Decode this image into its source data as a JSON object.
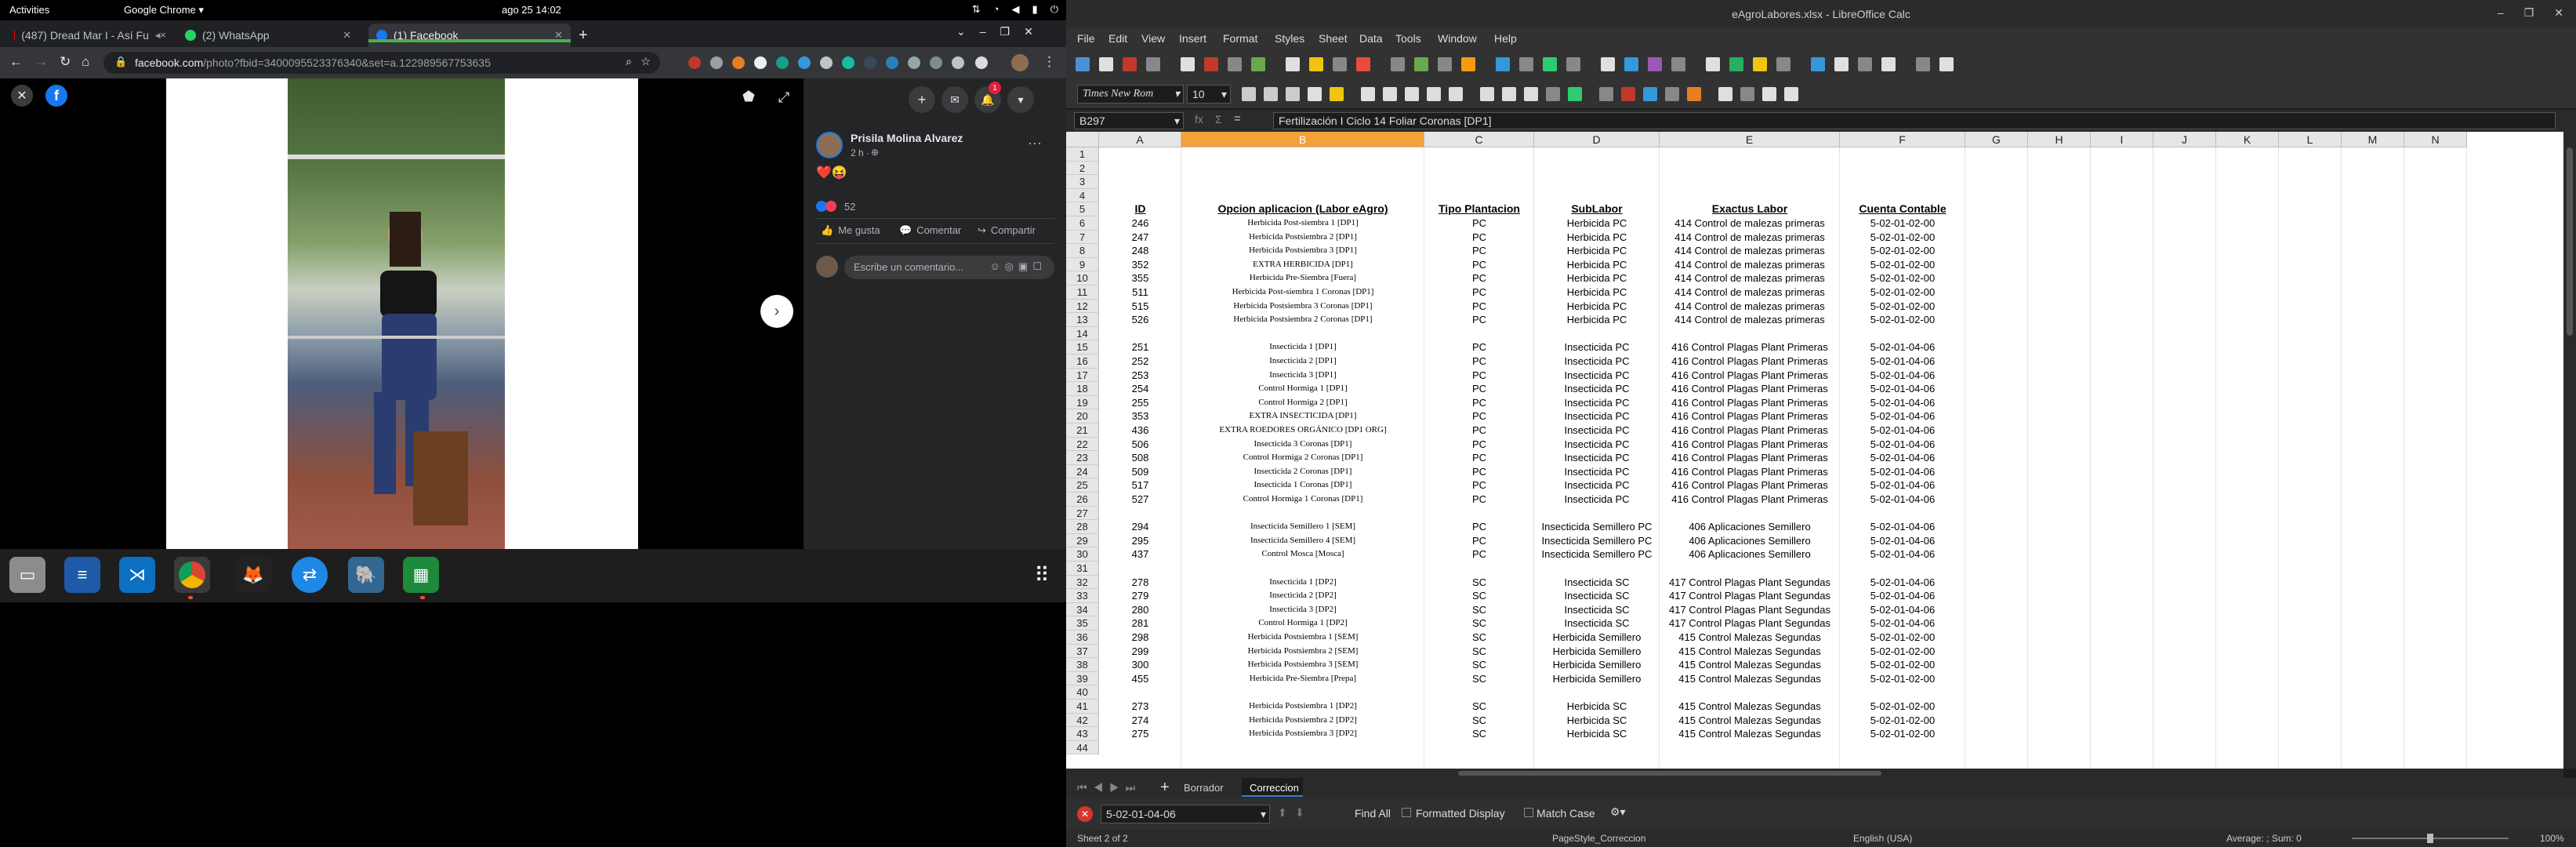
{
  "topbar": {
    "activities": "Activities",
    "app": "Google Chrome ▾",
    "clock": "ago 25  14:02"
  },
  "chrome": {
    "tabs": [
      {
        "label": "(487) Dread Mar I - Así Fu"
      },
      {
        "label": "(2) WhatsApp"
      },
      {
        "label": "(1) Facebook"
      }
    ],
    "url_prefix": "facebook.com",
    "url_rest": "/photo?fbid=340009552337634​0&set=a.12298956775​3635"
  },
  "facebook": {
    "author": "Prisila Molina Alvarez",
    "time": "2 h · ",
    "reaction_emoji": "❤️😝",
    "reaction_count": "52",
    "like": "Me gusta",
    "comment": "Comentar",
    "share": "Compartir",
    "comment_placeholder": "Escribe un comentario...",
    "notif_count": "1"
  },
  "calc": {
    "title": "eAgroLabores.xlsx - LibreOffice Calc",
    "menu": [
      "File",
      "Edit",
      "View",
      "Insert",
      "Format",
      "Styles",
      "Sheet",
      "Data",
      "Tools",
      "Window",
      "Help"
    ],
    "font_name": "Times New Rom",
    "font_size": "10",
    "name_box": "B297",
    "formula": "Fertilización I Ciclo 14 Foliar Coronas [DP1]",
    "columns": [
      "A",
      "B",
      "C",
      "D",
      "E",
      "F",
      "G",
      "H",
      "I",
      "J",
      "K",
      "L",
      "M",
      "N"
    ],
    "rows": [
      {
        "n": "1"
      },
      {
        "n": "2"
      },
      {
        "n": "3"
      },
      {
        "n": "4"
      },
      {
        "n": "5",
        "a": "ID",
        "b": "Opcion aplicacion (Labor eAgro)",
        "c": "Tipo Plantacion",
        "d": "SubLabor",
        "e": "Exactus Labor",
        "f": "Cuenta Contable",
        "h": true
      },
      {
        "n": "6",
        "a": "246",
        "b": "Herbicida Post-siembra 1 [DP1]",
        "c": "PC",
        "d": "Herbicida PC",
        "e": "414 Control de malezas primeras",
        "f": "5-02-01-02-00"
      },
      {
        "n": "7",
        "a": "247",
        "b": "Herbicida Postsiembra 2 [DP1]",
        "c": "PC",
        "d": "Herbicida PC",
        "e": "414 Control de malezas primeras",
        "f": "5-02-01-02-00"
      },
      {
        "n": "8",
        "a": "248",
        "b": "Herbicida Postsiembra 3 [DP1]",
        "c": "PC",
        "d": "Herbicida PC",
        "e": "414 Control de malezas primeras",
        "f": "5-02-01-02-00"
      },
      {
        "n": "9",
        "a": "352",
        "b": "EXTRA HERBICIDA [DP1]",
        "c": "PC",
        "d": "Herbicida PC",
        "e": "414 Control de malezas primeras",
        "f": "5-02-01-02-00"
      },
      {
        "n": "10",
        "a": "355",
        "b": "Herbicida Pre-Siembra [Fuera]",
        "c": "PC",
        "d": "Herbicida PC",
        "e": "414 Control de malezas primeras",
        "f": "5-02-01-02-00"
      },
      {
        "n": "11",
        "a": "511",
        "b": "Herbicida Post-siembra 1 Coronas [DP1]",
        "c": "PC",
        "d": "Herbicida PC",
        "e": "414 Control de malezas primeras",
        "f": "5-02-01-02-00"
      },
      {
        "n": "12",
        "a": "515",
        "b": "Herbicida Postsiembra 3 Coronas [DP1]",
        "c": "PC",
        "d": "Herbicida PC",
        "e": "414 Control de malezas primeras",
        "f": "5-02-01-02-00"
      },
      {
        "n": "13",
        "a": "526",
        "b": "Herbicida Postsiembra 2 Coronas [DP1]",
        "c": "PC",
        "d": "Herbicida PC",
        "e": "414 Control de malezas primeras",
        "f": "5-02-01-02-00"
      },
      {
        "n": "14"
      },
      {
        "n": "15",
        "a": "251",
        "b": "Insecticida 1 [DP1]",
        "c": "PC",
        "d": "Insecticida PC",
        "e": "416 Control Plagas Plant Primeras",
        "f": "5-02-01-04-06"
      },
      {
        "n": "16",
        "a": "252",
        "b": "Insecticida 2 [DP1]",
        "c": "PC",
        "d": "Insecticida PC",
        "e": "416 Control Plagas Plant Primeras",
        "f": "5-02-01-04-06"
      },
      {
        "n": "17",
        "a": "253",
        "b": "Insecticida 3 [DP1]",
        "c": "PC",
        "d": "Insecticida PC",
        "e": "416 Control Plagas Plant Primeras",
        "f": "5-02-01-04-06"
      },
      {
        "n": "18",
        "a": "254",
        "b": "Control Hormiga 1 [DP1]",
        "c": "PC",
        "d": "Insecticida PC",
        "e": "416 Control Plagas Plant Primeras",
        "f": "5-02-01-04-06"
      },
      {
        "n": "19",
        "a": "255",
        "b": "Control Hormiga 2 [DP1]",
        "c": "PC",
        "d": "Insecticida PC",
        "e": "416 Control Plagas Plant Primeras",
        "f": "5-02-01-04-06"
      },
      {
        "n": "20",
        "a": "353",
        "b": "EXTRA INSECTICIDA [DP1]",
        "c": "PC",
        "d": "Insecticida PC",
        "e": "416 Control Plagas Plant Primeras",
        "f": "5-02-01-04-06"
      },
      {
        "n": "21",
        "a": "436",
        "b": "EXTRA ROEDORES ORGÁNICO [DP1 ORG]",
        "c": "PC",
        "d": "Insecticida PC",
        "e": "416 Control Plagas Plant Primeras",
        "f": "5-02-01-04-06"
      },
      {
        "n": "22",
        "a": "506",
        "b": "Insecticida 3 Coronas [DP1]",
        "c": "PC",
        "d": "Insecticida PC",
        "e": "416 Control Plagas Plant Primeras",
        "f": "5-02-01-04-06"
      },
      {
        "n": "23",
        "a": "508",
        "b": "Control Hormiga 2 Coronas [DP1]",
        "c": "PC",
        "d": "Insecticida PC",
        "e": "416 Control Plagas Plant Primeras",
        "f": "5-02-01-04-06"
      },
      {
        "n": "24",
        "a": "509",
        "b": "Insecticida 2 Coronas [DP1]",
        "c": "PC",
        "d": "Insecticida PC",
        "e": "416 Control Plagas Plant Primeras",
        "f": "5-02-01-04-06"
      },
      {
        "n": "25",
        "a": "517",
        "b": "Insecticida 1 Coronas [DP1]",
        "c": "PC",
        "d": "Insecticida PC",
        "e": "416 Control Plagas Plant Primeras",
        "f": "5-02-01-04-06"
      },
      {
        "n": "26",
        "a": "527",
        "b": "Control Hormiga 1 Coronas [DP1]",
        "c": "PC",
        "d": "Insecticida PC",
        "e": "416 Control Plagas Plant Primeras",
        "f": "5-02-01-04-06"
      },
      {
        "n": "27"
      },
      {
        "n": "28",
        "a": "294",
        "b": "Insecticida Semillero 1 [SEM]",
        "c": "PC",
        "d": "Insecticida Semillero PC",
        "e": "406 Aplicaciones Semillero",
        "f": "5-02-01-04-06"
      },
      {
        "n": "29",
        "a": "295",
        "b": "Insecticida Semillero 4 [SEM]",
        "c": "PC",
        "d": "Insecticida Semillero PC",
        "e": "406 Aplicaciones Semillero",
        "f": "5-02-01-04-06"
      },
      {
        "n": "30",
        "a": "437",
        "b": "Control Mosca [Mosca]",
        "c": "PC",
        "d": "Insecticida Semillero PC",
        "e": "406 Aplicaciones Semillero",
        "f": "5-02-01-04-06"
      },
      {
        "n": "31"
      },
      {
        "n": "32",
        "a": "278",
        "b": "Insecticida 1 [DP2]",
        "c": "SC",
        "d": "Insecticida SC",
        "e": "417 Control Plagas Plant Segundas",
        "f": "5-02-01-04-06"
      },
      {
        "n": "33",
        "a": "279",
        "b": "Insecticida 2 [DP2]",
        "c": "SC",
        "d": "Insecticida SC",
        "e": "417 Control Plagas Plant Segundas",
        "f": "5-02-01-04-06"
      },
      {
        "n": "34",
        "a": "280",
        "b": "Insecticida 3 [DP2]",
        "c": "SC",
        "d": "Insecticida SC",
        "e": "417 Control Plagas Plant Segundas",
        "f": "5-02-01-04-06"
      },
      {
        "n": "35",
        "a": "281",
        "b": "Control Hormiga 1 [DP2]",
        "c": "SC",
        "d": "Insecticida SC",
        "e": "417 Control Plagas Plant Segundas",
        "f": "5-02-01-04-06"
      },
      {
        "n": "36",
        "a": "298",
        "b": "Herbicida Postsiembra 1 [SEM]",
        "c": "SC",
        "d": "Herbicida Semillero",
        "e": "415 Control Malezas Segundas",
        "f": "5-02-01-02-00"
      },
      {
        "n": "37",
        "a": "299",
        "b": "Herbicida Postsiembra 2 [SEM]",
        "c": "SC",
        "d": "Herbicida Semillero",
        "e": "415 Control Malezas Segundas",
        "f": "5-02-01-02-00"
      },
      {
        "n": "38",
        "a": "300",
        "b": "Herbicida Postsiembra 3 [SEM]",
        "c": "SC",
        "d": "Herbicida Semillero",
        "e": "415 Control Malezas Segundas",
        "f": "5-02-01-02-00"
      },
      {
        "n": "39",
        "a": "455",
        "b": "Herbicida Pre-Siembra [Prepa]",
        "c": "SC",
        "d": "Herbicida Semillero",
        "e": "415 Control Malezas Segundas",
        "f": "5-02-01-02-00"
      },
      {
        "n": "40"
      },
      {
        "n": "41",
        "a": "273",
        "b": "Herbicida Postsiembra 1 [DP2]",
        "c": "SC",
        "d": "Herbicida SC",
        "e": "415 Control Malezas Segundas",
        "f": "5-02-01-02-00"
      },
      {
        "n": "42",
        "a": "274",
        "b": "Herbicida Postsiembra 2 [DP2]",
        "c": "SC",
        "d": "Herbicida SC",
        "e": "415 Control Malezas Segundas",
        "f": "5-02-01-02-00"
      },
      {
        "n": "43",
        "a": "275",
        "b": "Herbicida Postsiembra 3 [DP2]",
        "c": "SC",
        "d": "Herbicida SC",
        "e": "415 Control Malezas Segundas",
        "f": "5-02-01-02-00"
      },
      {
        "n": "44"
      }
    ],
    "sheet_tabs": [
      "Borrador",
      "Correccion"
    ],
    "find_value": "5-02-01-04-06",
    "find_all": "Find All",
    "formatted_display": "Formatted Display",
    "match_case": "Match Case",
    "status_sheet": "Sheet 2 of 2",
    "status_style": "PageStyle_Correccion",
    "status_lang": "English (USA)",
    "status_sum": "Average: ; Sum: 0",
    "status_zoom": "100%"
  }
}
